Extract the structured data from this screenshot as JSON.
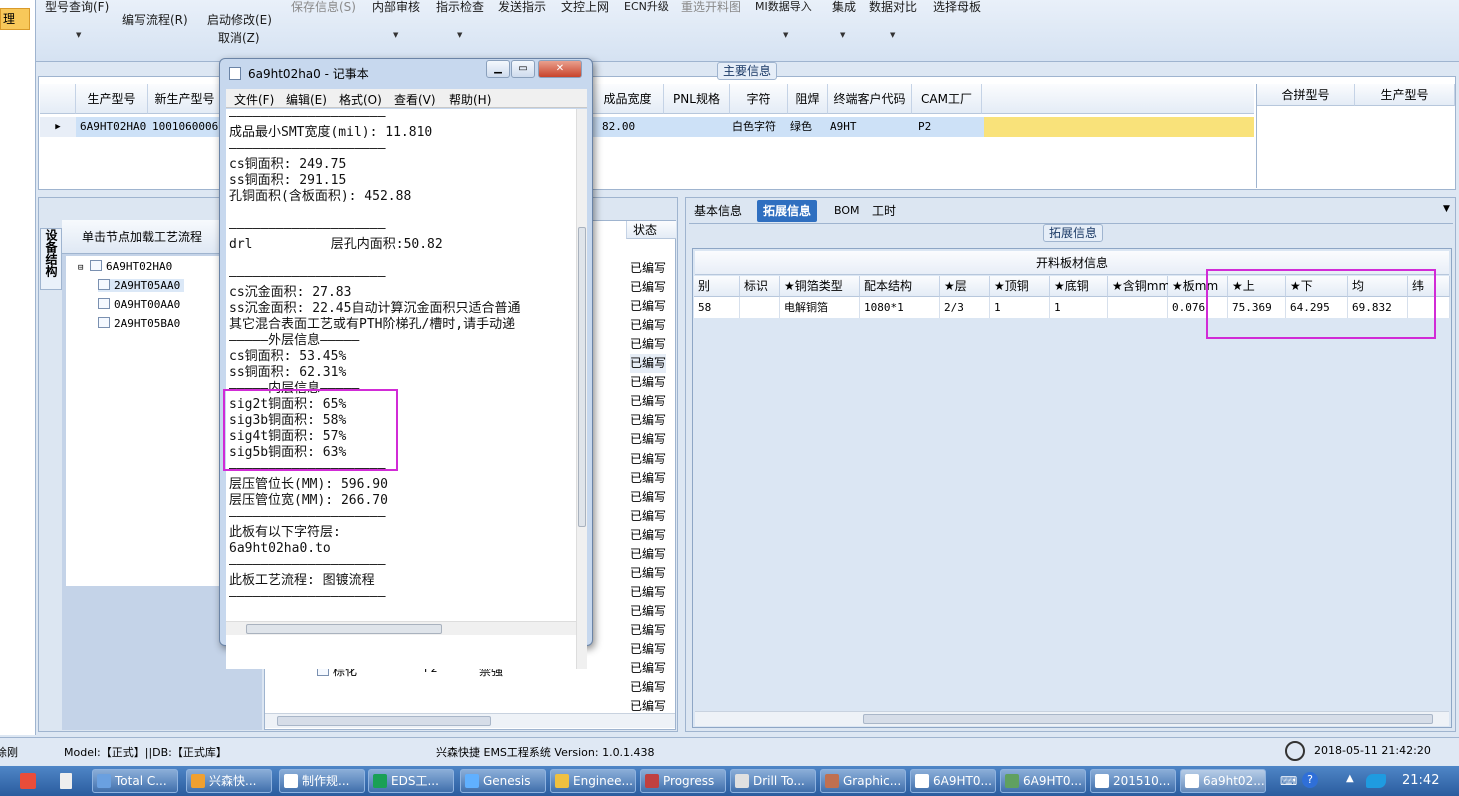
{
  "ribbon": {
    "items": [
      {
        "label": "型号查询(F)",
        "disabled": false
      },
      {
        "label": "编写流程(R)",
        "disabled": false
      },
      {
        "label": "启动修改(E)",
        "disabled": false
      },
      {
        "label": "取消(Z)",
        "disabled": false
      },
      {
        "label": "保存信息(S)",
        "disabled": true
      },
      {
        "label": "内部审核",
        "disabled": false
      },
      {
        "label": "指示检查",
        "disabled": false
      },
      {
        "label": "发送指示",
        "disabled": false
      },
      {
        "label": "文控上网",
        "disabled": false
      },
      {
        "label": "ECN升级",
        "disabled": false
      },
      {
        "label": "重选开料图",
        "disabled": true
      },
      {
        "label": "MI数据导入",
        "disabled": false
      },
      {
        "label": "集成",
        "disabled": false
      },
      {
        "label": "数据对比",
        "disabled": false
      },
      {
        "label": "选择母板",
        "disabled": false
      }
    ],
    "left_selected": "理"
  },
  "main_info": {
    "group_title": "主要信息",
    "columns": [
      "生产型号",
      "新生产型号",
      "成品宽度",
      "PNL规格",
      "字符",
      "阻焊",
      "终端客户代码",
      "CAM工厂"
    ],
    "row": [
      "6A9HT02HA0",
      "1001060006000",
      "82.00",
      "",
      "白色字符",
      "绿色",
      "A9HT",
      "P2"
    ],
    "right_columns": [
      "合拼型号",
      "生产型号"
    ]
  },
  "left_panel": {
    "vertical_tab": "设备结构",
    "title": "单击节点加载工艺流程",
    "tree": [
      "6A9HT02HA0",
      "2A9HT05AA0",
      "0A9HT00AA0",
      "2A9HT05BA0"
    ]
  },
  "process_list": {
    "status_header": "状态",
    "status_value": "已编写",
    "status_count": 24,
    "bottom_rows": [
      {
        "name": "棕化",
        "site": "P2",
        "note": "禁强"
      },
      {
        "name": "棕化",
        "site": "P2",
        "note": "禁强"
      }
    ]
  },
  "notepad": {
    "title": "6a9ht02ha0 - 记事本",
    "menu": [
      "文件(F)",
      "编辑(E)",
      "格式(O)",
      "查看(V)",
      "帮助(H)"
    ],
    "lines": [
      "————————————————————",
      "成品最小SMT宽度(mil): 11.810",
      "————————————————————",
      "cs铜面积: 249.75",
      "ss铜面积: 291.15",
      "孔铜面积(含板面积): 452.88",
      "",
      "————————————————————",
      "drl          层孔内面积:50.82",
      "",
      "————————————————————",
      "cs沉金面积: 27.83",
      "ss沉金面积: 22.45自动计算沉金面积只适合普通",
      "其它混合表面工艺或有PTH阶梯孔/槽时,请手动递",
      "—————外层信息—————",
      "cs铜面积: 53.45%",
      "ss铜面积: 62.31%",
      "—————内层信息—————",
      "sig2t铜面积: 65%",
      "sig3b铜面积: 58%",
      "sig4t铜面积: 57%",
      "sig5b铜面积: 63%",
      "————————————————————",
      "层压管位长(MM): 596.90",
      "层压管位宽(MM): 266.70",
      "————————————————————",
      "此板有以下字符层:",
      "6a9ht02ha0.to",
      "————————————————————",
      "此板工艺流程: 图镀流程",
      "————————————————————"
    ]
  },
  "right_panel": {
    "tabs": [
      "基本信息",
      "拓展信息",
      "BOM",
      "工时"
    ],
    "active_tab": "拓展信息",
    "group_title": "拓展信息",
    "grid_title": "开料板材信息",
    "columns": [
      "别",
      "标识",
      "★铜箔类型",
      "配本结构",
      "★层",
      "★顶铜",
      "★底铜",
      "★含铜mm",
      "★板mm",
      "★上",
      "★下",
      "均",
      "纬"
    ],
    "row": [
      "58",
      "",
      "电解铜箔",
      "1080*1",
      "2/3",
      "1",
      "1",
      "",
      "0.076",
      "75.369",
      "64.295",
      "69.832",
      ""
    ]
  },
  "status_bar": {
    "left": "徐刚",
    "model": "Model:【正式】||DB:【正式库】",
    "center": "兴森快捷 EMS工程系统 Version: 1.0.1.438",
    "datetime": "2018-05-11 21:42:20"
  },
  "taskbar": {
    "items": [
      "Total C...",
      "兴森快...",
      "制作规...",
      "EDS工...",
      "Genesis",
      "Enginee...",
      "Progress",
      "Drill To...",
      "Graphic...",
      "6A9HT0...",
      "6A9HT0...",
      "201510...",
      "6a9ht02..."
    ],
    "clock": "21:42"
  },
  "colors": {
    "highlight": "#d12bd6",
    "selected_row": "#cde1f7",
    "tab_active": "#2f6fc0",
    "yellow_cell": "#f9e27a"
  }
}
